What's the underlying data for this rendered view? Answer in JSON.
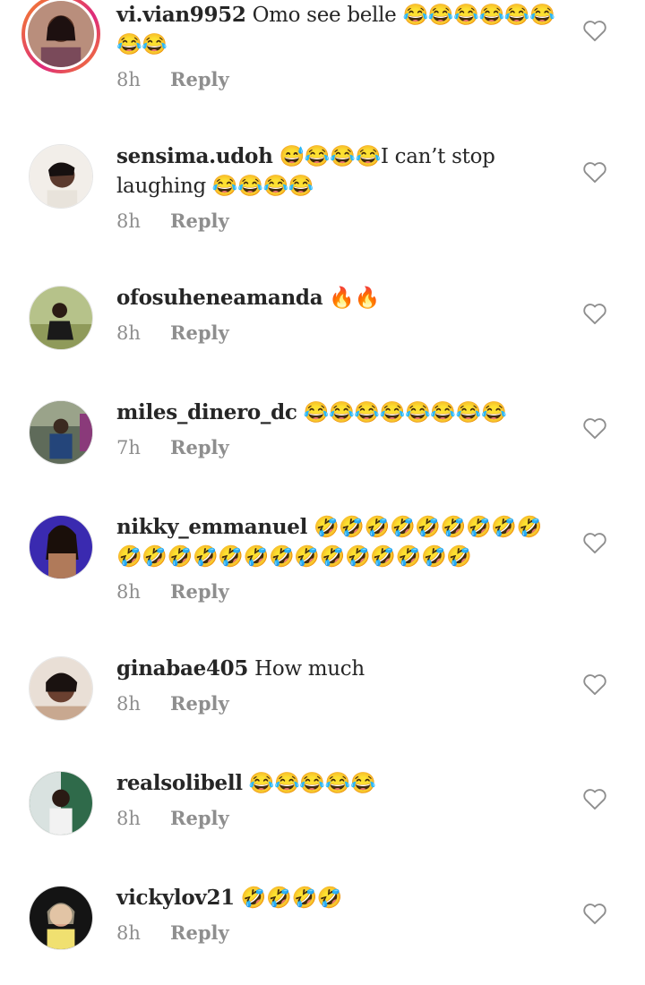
{
  "comments": [
    {
      "username": "vi.vian9952",
      "text": "Omo see belle 😂😂😂😂😂😂😂😂",
      "time": "8h",
      "reply": "Reply"
    },
    {
      "username": "sensima.udoh",
      "text": "😅😂😂😂I can’t stop laughing 😂😂😂😂",
      "time": "8h",
      "reply": "Reply"
    },
    {
      "username": "ofosuheneamanda",
      "text": "🔥🔥",
      "time": "8h",
      "reply": "Reply"
    },
    {
      "username": "miles_dinero_dc",
      "text": "😂😂😂😂😂😂😂😂",
      "time": "7h",
      "reply": "Reply"
    },
    {
      "username": "nikky_emmanuel",
      "text": "🤣🤣🤣🤣🤣🤣🤣🤣🤣🤣🤣🤣🤣🤣🤣🤣🤣🤣🤣🤣🤣🤣🤣",
      "time": "8h",
      "reply": "Reply"
    },
    {
      "username": "ginabae405",
      "text": "How much",
      "time": "8h",
      "reply": "Reply"
    },
    {
      "username": "realsolibell",
      "text": "😂😂😂😂😂",
      "time": "8h",
      "reply": "Reply"
    },
    {
      "username": "vickylov21",
      "text": "🤣🤣🤣🤣",
      "time": "8h",
      "reply": "Reply"
    }
  ]
}
